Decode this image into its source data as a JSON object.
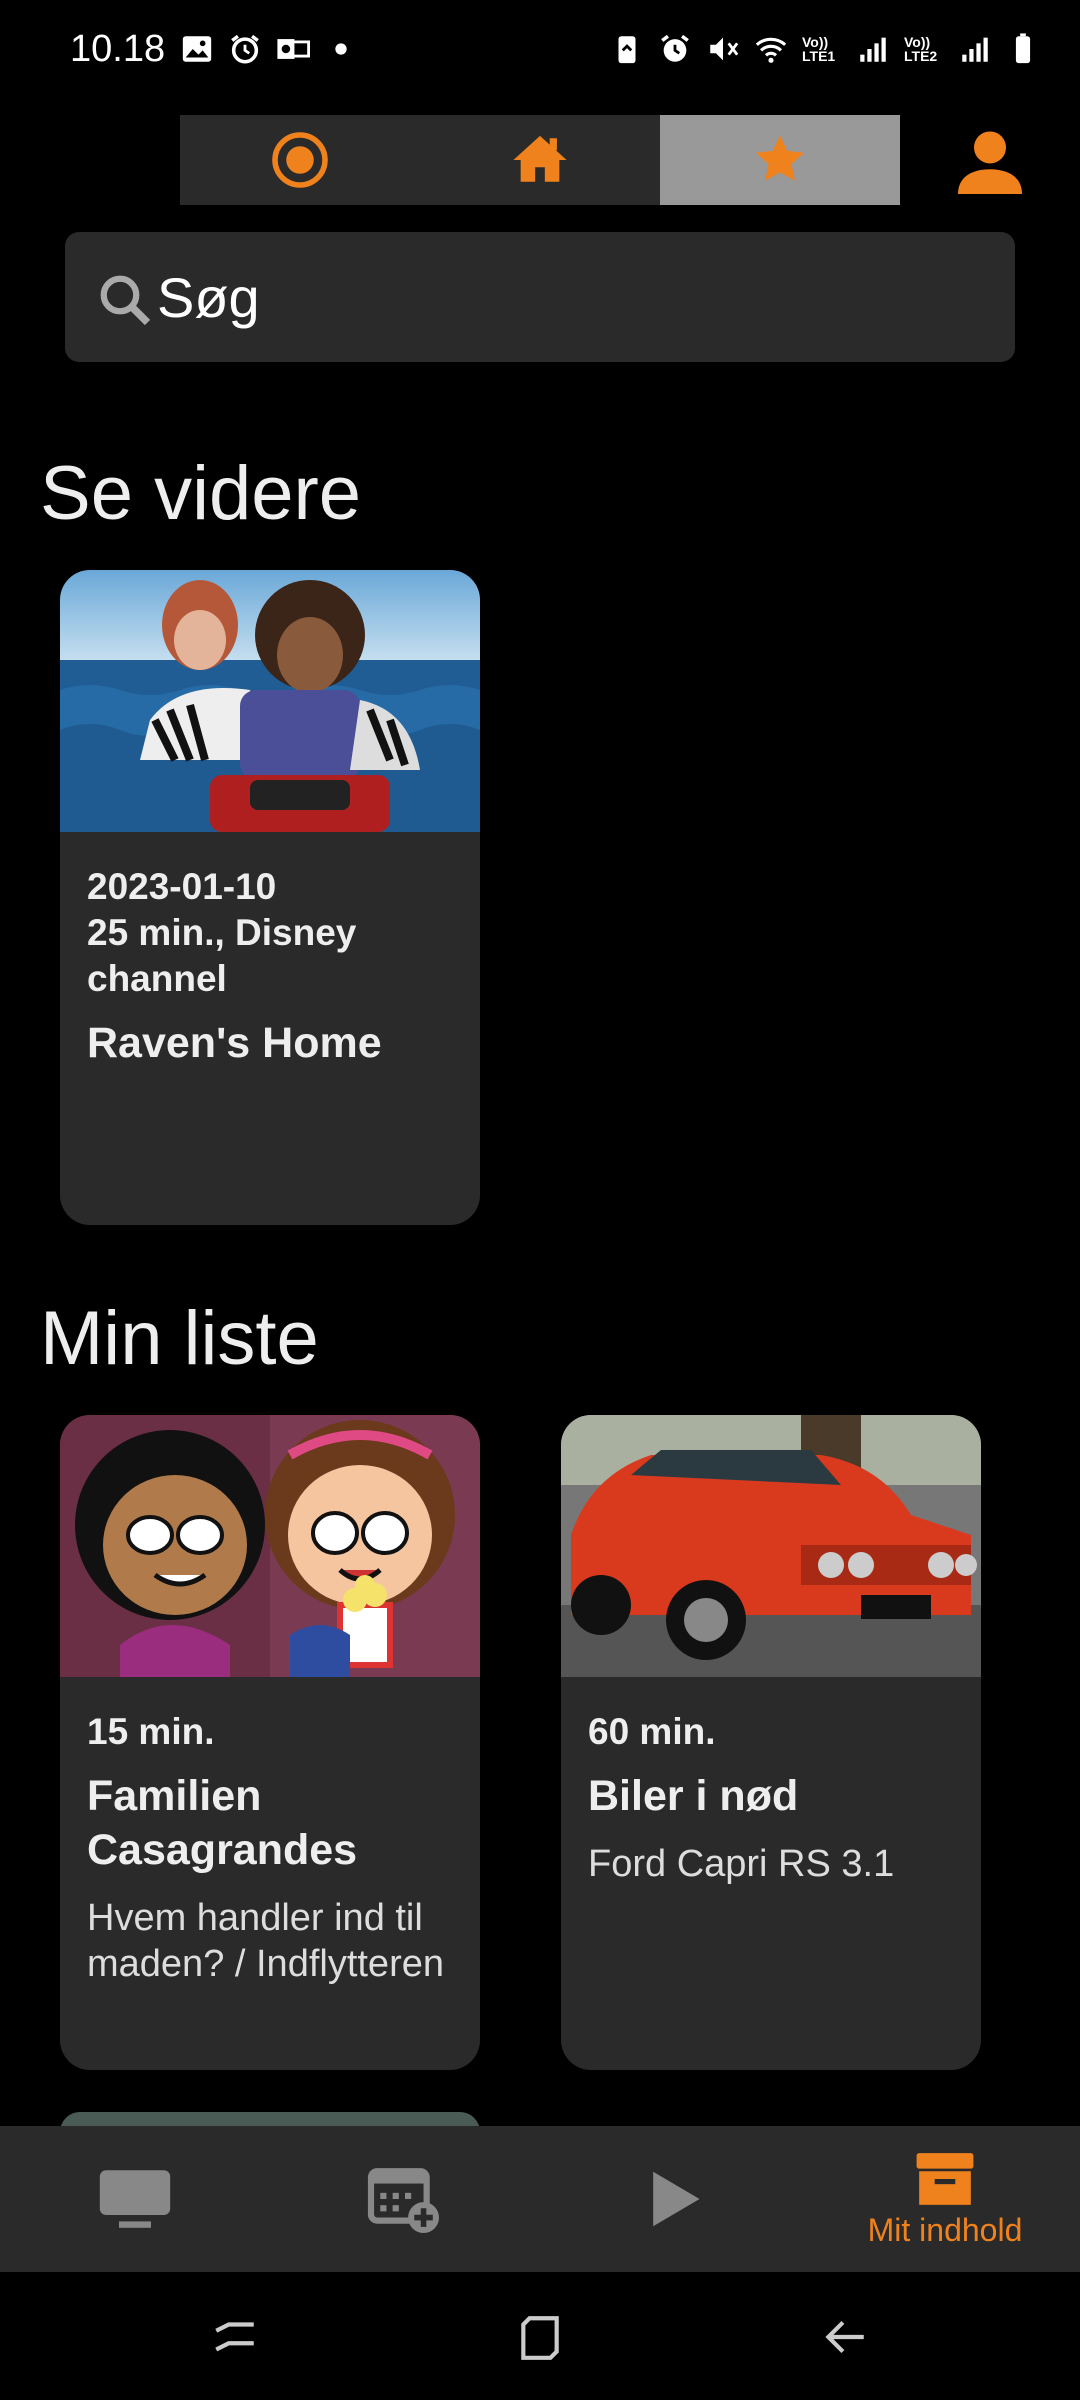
{
  "status_bar": {
    "time": "10.18",
    "sim1_label": "Vo)) LTE1",
    "sim2_label": "Vo)) LTE2",
    "left_icons": [
      "gallery-icon",
      "alarm-icon",
      "outlook-icon",
      "dot-icon"
    ],
    "right_icons": [
      "battery-saver-icon",
      "alarm-icon",
      "mute-icon",
      "wifi-icon",
      "signal-icon",
      "signal-icon",
      "battery-icon"
    ]
  },
  "top_nav": {
    "tabs": [
      {
        "icon": "live-record-icon",
        "active": false
      },
      {
        "icon": "home-icon",
        "active": false
      },
      {
        "icon": "star-icon",
        "active": true
      }
    ],
    "profile_icon": "person-icon"
  },
  "search": {
    "placeholder": "Søg"
  },
  "continue_watching": {
    "title": "Se videre",
    "items": [
      {
        "date": "2023-01-10",
        "info": "25 min., Disney channel",
        "title": "Raven's Home",
        "description": ""
      }
    ]
  },
  "my_list": {
    "title": "Min liste",
    "items": [
      {
        "info": "15 min.",
        "title": "Familien Casagrandes",
        "description": "Hvem handler ind til maden? / Indflytteren"
      },
      {
        "info": "60 min.",
        "title": "Biler i nød",
        "description": "Ford Capri RS 3.1"
      }
    ]
  },
  "bottom_nav": {
    "items": [
      {
        "icon": "tv-icon",
        "label": "",
        "active": false
      },
      {
        "icon": "calendar-add-icon",
        "label": "",
        "active": false
      },
      {
        "icon": "play-icon",
        "label": "",
        "active": false
      },
      {
        "icon": "archive-box-icon",
        "label": "Mit indhold",
        "active": true
      }
    ]
  },
  "colors": {
    "accent": "#f0821e",
    "background": "#000000",
    "surface": "#2a2a2a",
    "active_tab": "#999999"
  }
}
